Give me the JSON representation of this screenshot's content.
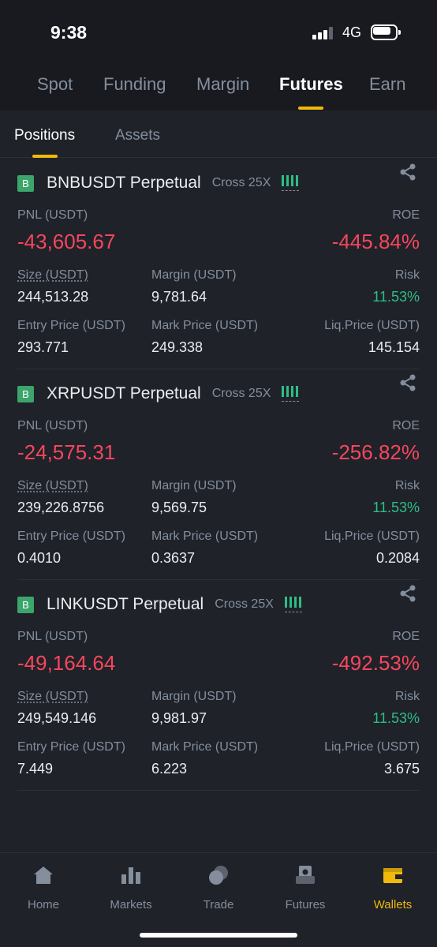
{
  "status": {
    "time": "9:38",
    "network": "4G"
  },
  "main_tabs": [
    {
      "label": "Spot"
    },
    {
      "label": "Funding"
    },
    {
      "label": "Margin"
    },
    {
      "label": "Futures"
    },
    {
      "label": "Earn"
    }
  ],
  "sub_tabs": [
    {
      "label": "Positions"
    },
    {
      "label": "Assets"
    }
  ],
  "positions": [
    {
      "badge": "B",
      "symbol": "BNBUSDT Perpetual",
      "leverage": "Cross 25X",
      "pnl_label": "PNL (USDT)",
      "pnl": "-43,605.67",
      "roe_label": "ROE",
      "roe": "-445.84%",
      "size_label": "Size (USDT)",
      "size": "244,513.28",
      "margin_label": "Margin (USDT)",
      "margin": "9,781.64",
      "risk_label": "Risk",
      "risk": "11.53%",
      "entry_label": "Entry Price (USDT)",
      "entry": "293.771",
      "mark_label": "Mark Price (USDT)",
      "mark": "249.338",
      "liq_label": "Liq.Price (USDT)",
      "liq": "145.154"
    },
    {
      "badge": "B",
      "symbol": "XRPUSDT Perpetual",
      "leverage": "Cross 25X",
      "pnl_label": "PNL (USDT)",
      "pnl": "-24,575.31",
      "roe_label": "ROE",
      "roe": "-256.82%",
      "size_label": "Size (USDT)",
      "size": "239,226.8756",
      "margin_label": "Margin (USDT)",
      "margin": "9,569.75",
      "risk_label": "Risk",
      "risk": "11.53%",
      "entry_label": "Entry Price (USDT)",
      "entry": "0.4010",
      "mark_label": "Mark Price (USDT)",
      "mark": "0.3637",
      "liq_label": "Liq.Price (USDT)",
      "liq": "0.2084"
    },
    {
      "badge": "B",
      "symbol": "LINKUSDT Perpetual",
      "leverage": "Cross 25X",
      "pnl_label": "PNL (USDT)",
      "pnl": "-49,164.64",
      "roe_label": "ROE",
      "roe": "-492.53%",
      "size_label": "Size (USDT)",
      "size": "249,549.146",
      "margin_label": "Margin (USDT)",
      "margin": "9,981.97",
      "risk_label": "Risk",
      "risk": "11.53%",
      "entry_label": "Entry Price (USDT)",
      "entry": "7.449",
      "mark_label": "Mark Price (USDT)",
      "mark": "6.223",
      "liq_label": "Liq.Price (USDT)",
      "liq": "3.675"
    }
  ],
  "bottom_nav": [
    {
      "label": "Home",
      "icon": "home-icon"
    },
    {
      "label": "Markets",
      "icon": "markets-icon"
    },
    {
      "label": "Trade",
      "icon": "trade-icon"
    },
    {
      "label": "Futures",
      "icon": "futures-icon"
    },
    {
      "label": "Wallets",
      "icon": "wallet-icon"
    }
  ],
  "colors": {
    "accent": "#f0b90b",
    "negative": "#f6465d",
    "positive": "#2ebd85",
    "background": "#1f2229"
  }
}
